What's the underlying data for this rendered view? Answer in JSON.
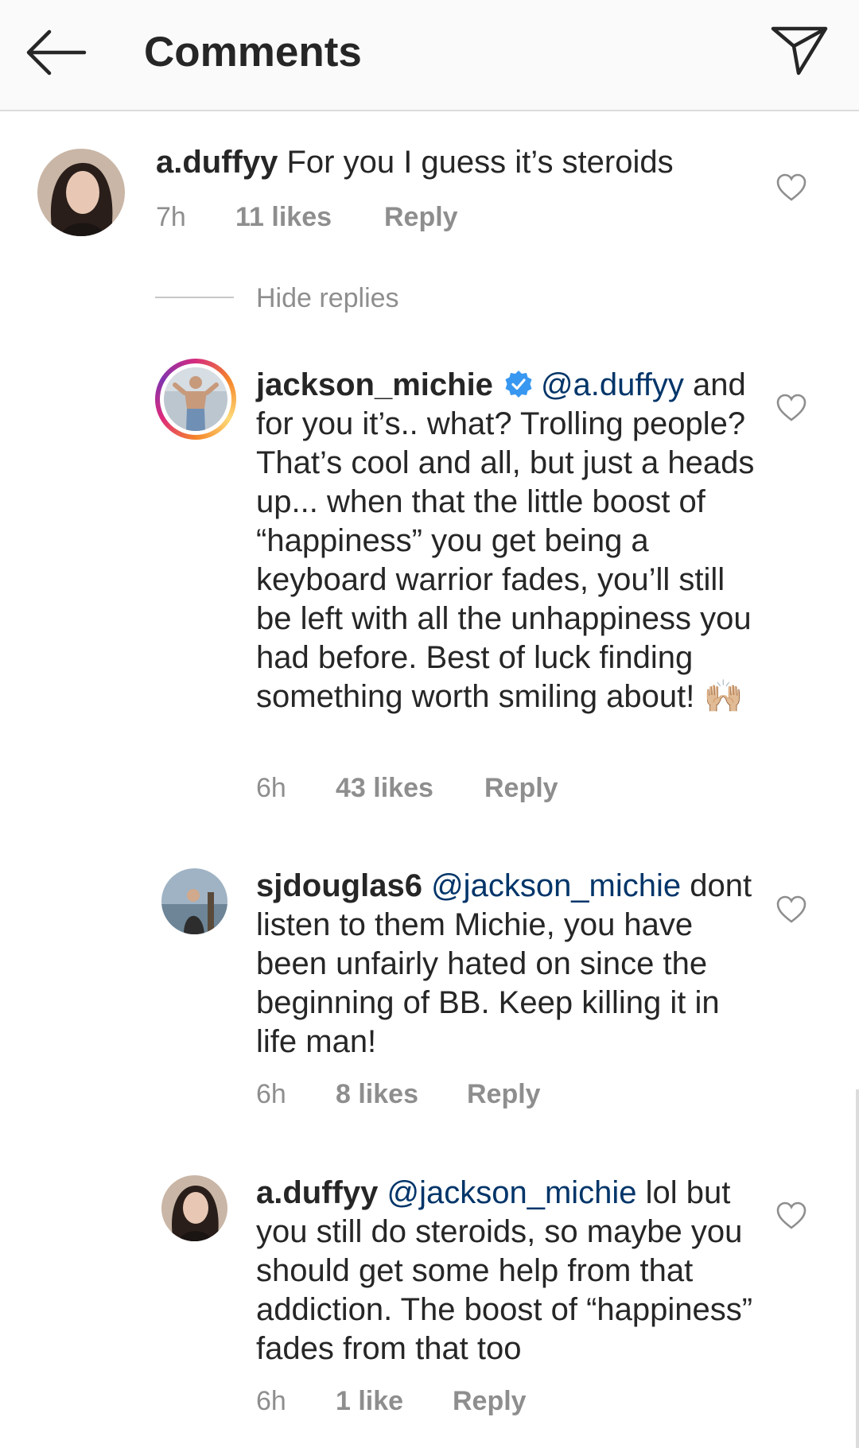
{
  "header": {
    "title": "Comments",
    "back_icon": "arrow-left-icon",
    "share_icon": "paper-plane-icon"
  },
  "colors": {
    "text": "#262626",
    "muted": "#8e8e8e",
    "mention": "#003569",
    "verified": "#3897f0",
    "header_bg": "#fafafa"
  },
  "comments": [
    {
      "username": "a.duffyy",
      "text": "For you I guess it’s steroids",
      "time": "7h",
      "likes": "11 likes",
      "reply": "Reply"
    }
  ],
  "hide_replies": "Hide replies",
  "replies": [
    {
      "username": "jackson_michie",
      "verified": true,
      "mention": "@a.duffyy",
      "text": "and for you it’s.. what? Trolling people? That’s cool and all, but just a heads up... when that the little boost of “happiness” you get being a keyboard warrior fades, you’ll still be left with all the unhappiness you had before. Best of luck finding something worth smiling about! 🙌🏼",
      "time": "6h",
      "likes": "43 likes",
      "reply": "Reply"
    },
    {
      "username": "sjdouglas6",
      "mention": "@jackson_michie",
      "text": "dont listen to them Michie, you have been unfairly hated on since the beginning of BB. Keep killing it in life man!",
      "time": "6h",
      "likes": "8 likes",
      "reply": "Reply"
    },
    {
      "username": "a.duffyy",
      "mention": "@jackson_michie",
      "text": "lol but you still do steroids, so maybe you should get some help from that addiction. The boost of “happiness” fades from that too",
      "time": "6h",
      "likes": "1 like",
      "reply": "Reply"
    }
  ]
}
